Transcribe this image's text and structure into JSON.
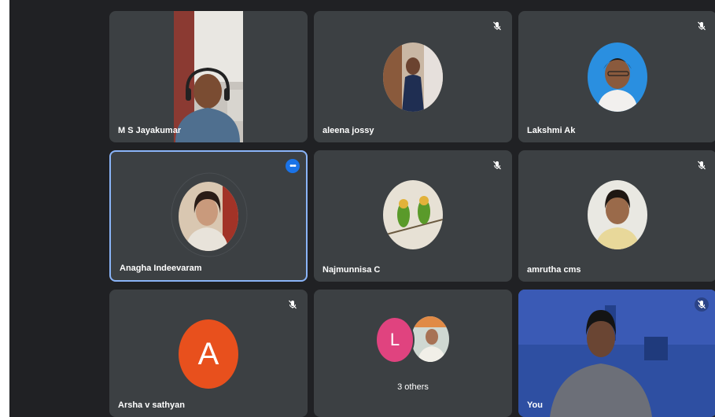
{
  "participants": [
    {
      "name": "M S Jayakumar",
      "muted": false
    },
    {
      "name": "aleena jossy",
      "muted": true
    },
    {
      "name": "Lakshmi Ak",
      "muted": true
    },
    {
      "name": "Anagha Indeevaram",
      "muted": false,
      "menu": "•••"
    },
    {
      "name": "Najmunnisa C",
      "muted": true
    },
    {
      "name": "amrutha cms",
      "muted": true
    },
    {
      "name": "Arsha v sathyan",
      "muted": true,
      "initial": "A"
    },
    {
      "group_initial": "L",
      "others_label": "3 others"
    },
    {
      "name": "You",
      "muted": true
    }
  ],
  "colors": {
    "background": "#202124",
    "tile": "#3c4043",
    "active_border": "#8ab4f8",
    "avatar_orange": "#e8501d",
    "avatar_pink": "#e0437f",
    "menu_blue": "#1a73e8"
  },
  "icons": [
    "mic-off-icon",
    "more-options-icon"
  ]
}
